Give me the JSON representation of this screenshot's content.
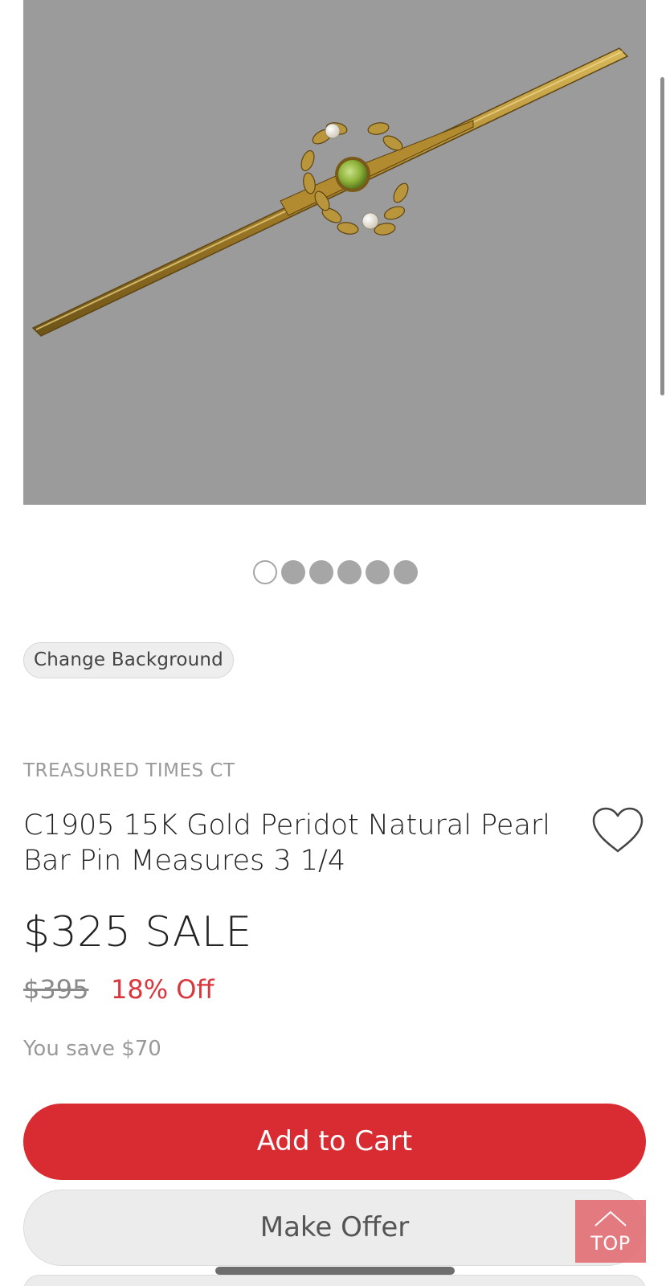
{
  "gallery": {
    "image_alt": "Gold bar pin with peridot and pearls",
    "slide_count": 6,
    "active_slide": 1
  },
  "change_background_label": "Change Background",
  "seller": "TREASURED TIMES CT",
  "product": {
    "title": "C1905 15K Gold Peridot Natural Pearl Bar Pin Measures 3 1/4",
    "price": "$325 SALE",
    "original_price": "$395",
    "discount": "18% Off",
    "savings": "You save $70"
  },
  "actions": {
    "add_to_cart": "Add to Cart",
    "make_offer": "Make Offer",
    "top": "TOP"
  },
  "icons": {
    "favorite": "heart-outline-icon",
    "top": "chevron-up-icon"
  },
  "colors": {
    "accent": "#d92b32",
    "discount": "#d9363e",
    "image_background": "#9b9b9b"
  }
}
